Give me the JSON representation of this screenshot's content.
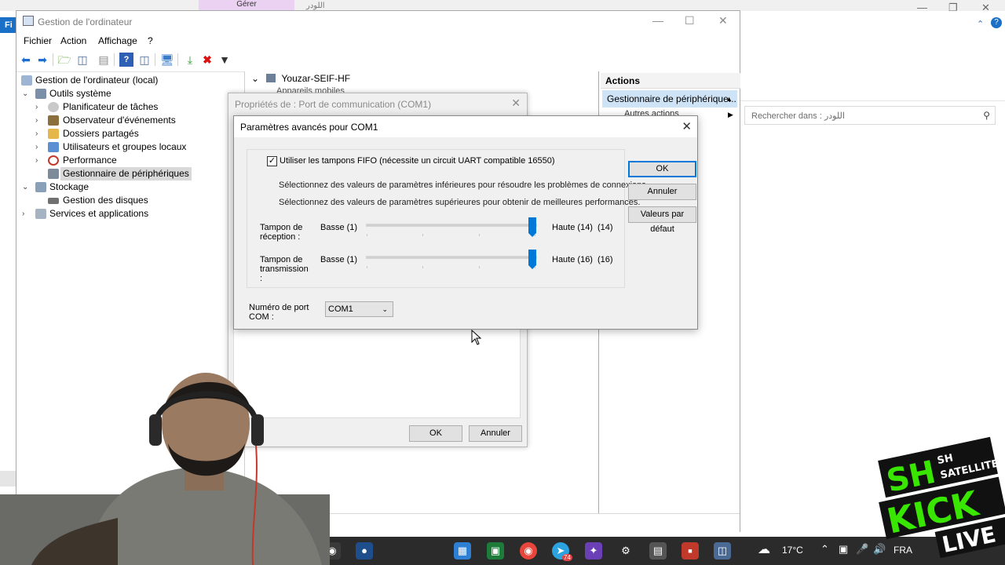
{
  "background_window": {
    "gerer_tab": "Gérer",
    "faint_title": "اللودر",
    "file_tab_short": "Fi",
    "search_placeholder": "Rechercher dans : اللودر"
  },
  "mmc": {
    "title": "Gestion de l'ordinateur",
    "menu": [
      "Fichier",
      "Action",
      "Affichage",
      "?"
    ],
    "tree": {
      "root": "Gestion de l'ordinateur (local)",
      "system_tools": "Outils système",
      "task_scheduler": "Planificateur de tâches",
      "event_viewer": "Observateur d'événements",
      "shared_folders": "Dossiers partagés",
      "local_users": "Utilisateurs et groupes locaux",
      "performance": "Performance",
      "device_manager": "Gestionnaire de périphériques",
      "storage": "Stockage",
      "disk_management": "Gestion des disques",
      "services_apps": "Services et applications"
    },
    "center": {
      "computer_node": "Youzar-SEIF-HF",
      "first_child": "Appareils mobiles"
    },
    "actions": {
      "header": "Actions",
      "selected": "Gestionnaire de périphérique...",
      "more": "Autres actions"
    }
  },
  "properties_dialog": {
    "title": "Propriétés de : Port de communication (COM1)",
    "ok": "OK",
    "cancel": "Annuler"
  },
  "advanced_dialog": {
    "title": "Paramètres avancés pour COM1",
    "fifo_label": "Utiliser les tampons FIFO (nécessite un circuit UART compatible 16550)",
    "fifo_checked": true,
    "info_low": "Sélectionnez des valeurs de paramètres inférieures pour résoudre les problèmes de connexions.",
    "info_high": "Sélectionnez des valeurs de paramètres supérieures pour obtenir de meilleures performances.",
    "receive": {
      "label": "Tampon de réception :",
      "low": "Basse (1)",
      "high": "Haute (14)",
      "value_text": "(14)",
      "value": 14,
      "max": 14
    },
    "transmit": {
      "label": "Tampon de transmission :",
      "low": "Basse (1)",
      "high": "Haute (16)",
      "value_text": "(16)",
      "value": 16,
      "max": 16
    },
    "port_label": "Numéro de port COM :",
    "port_value": "COM1",
    "ok": "OK",
    "cancel": "Annuler",
    "defaults": "Valeurs par défaut"
  },
  "taskbar": {
    "temperature": "17°C",
    "language": "FRA",
    "telegram_badge": "74"
  },
  "overlay": {
    "logo_lines": [
      "SH",
      "SH",
      "SATELLITE",
      "KICK",
      "LIVE"
    ]
  },
  "colors": {
    "accent": "#0078d7",
    "selection": "#cfe3f7",
    "taskbar": "#2b2b2b",
    "logo_green": "#39e600"
  }
}
